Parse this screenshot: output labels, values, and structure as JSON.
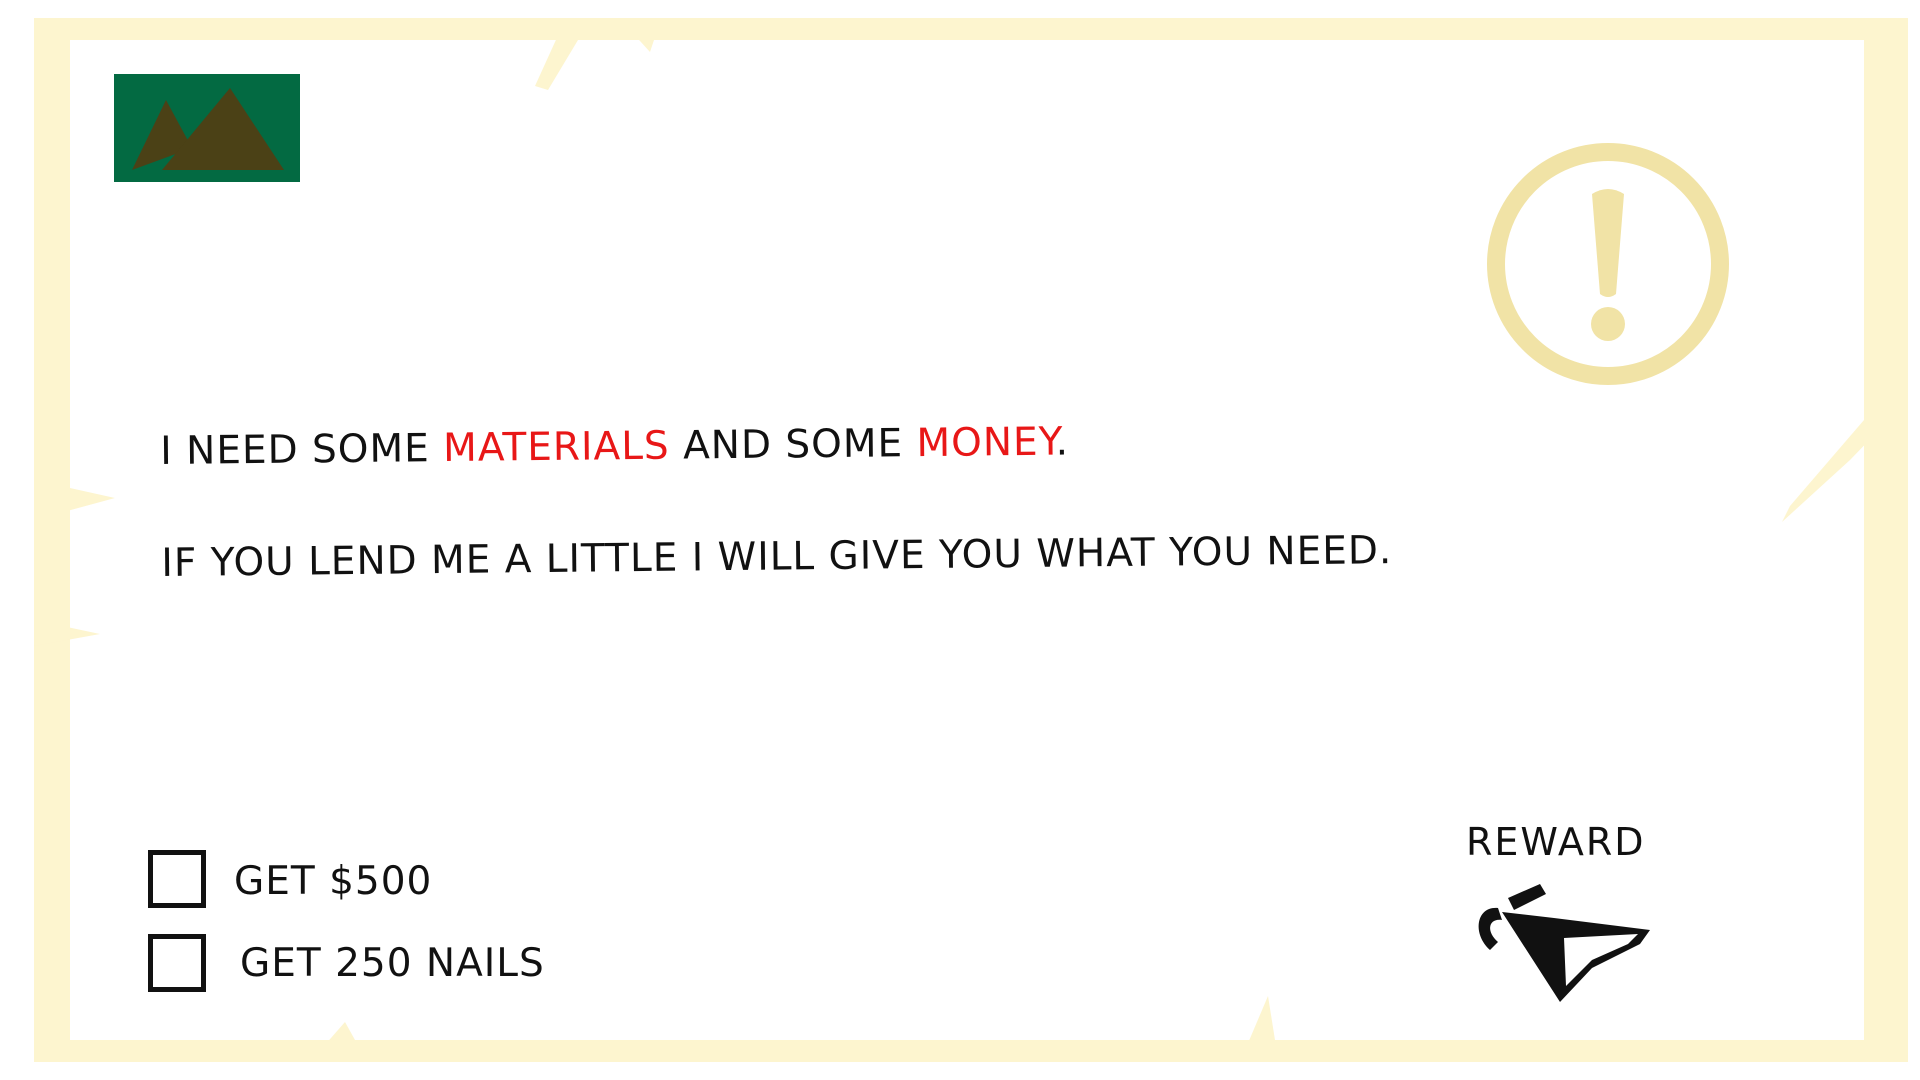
{
  "quest_card": {
    "colors": {
      "frame": "#fdf5cf",
      "map_background": "#036a42",
      "mountain": "#4b4116",
      "alert": "#f1e3a6",
      "highlight": "#e81717",
      "text": "#111111"
    },
    "map_icon": "mountains-icon",
    "alert_icon": "exclamation-icon",
    "message": {
      "line1": {
        "part1": "I NEED SOME ",
        "highlight1": "MATERIALS",
        "part2": " AND SOME ",
        "highlight2": "MONEY",
        "part3": "."
      },
      "line2": "IF YOU LEND ME A LITTLE I WILL GIVE YOU WHAT YOU NEED."
    },
    "options": [
      {
        "label": "GET $500",
        "checked": false
      },
      {
        "label": "GET 250 NAILS",
        "checked": false
      }
    ],
    "reward": {
      "label": "REWARD",
      "icon": "oil-can-icon"
    }
  }
}
